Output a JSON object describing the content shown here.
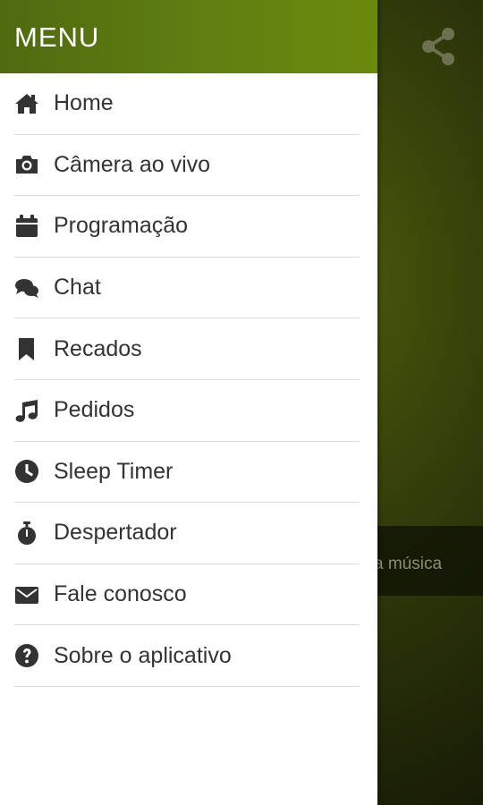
{
  "background": {
    "song_text": "a música",
    "share_icon": "share-icon"
  },
  "drawer": {
    "title": "MENU",
    "items": [
      {
        "label": "Home",
        "icon": "home-icon"
      },
      {
        "label": "Câmera ao vivo",
        "icon": "camera-icon"
      },
      {
        "label": "Programação",
        "icon": "calendar-icon"
      },
      {
        "label": "Chat",
        "icon": "chat-icon"
      },
      {
        "label": "Recados",
        "icon": "bookmark-icon"
      },
      {
        "label": "Pedidos",
        "icon": "music-icon"
      },
      {
        "label": "Sleep Timer",
        "icon": "clock-icon"
      },
      {
        "label": "Despertador",
        "icon": "stopwatch-icon"
      },
      {
        "label": "Fale conosco",
        "icon": "envelope-icon"
      },
      {
        "label": "Sobre o aplicativo",
        "icon": "help-icon"
      }
    ]
  },
  "colors": {
    "header": "#607f12",
    "text": "#333333",
    "divider": "#dcdcdc"
  }
}
